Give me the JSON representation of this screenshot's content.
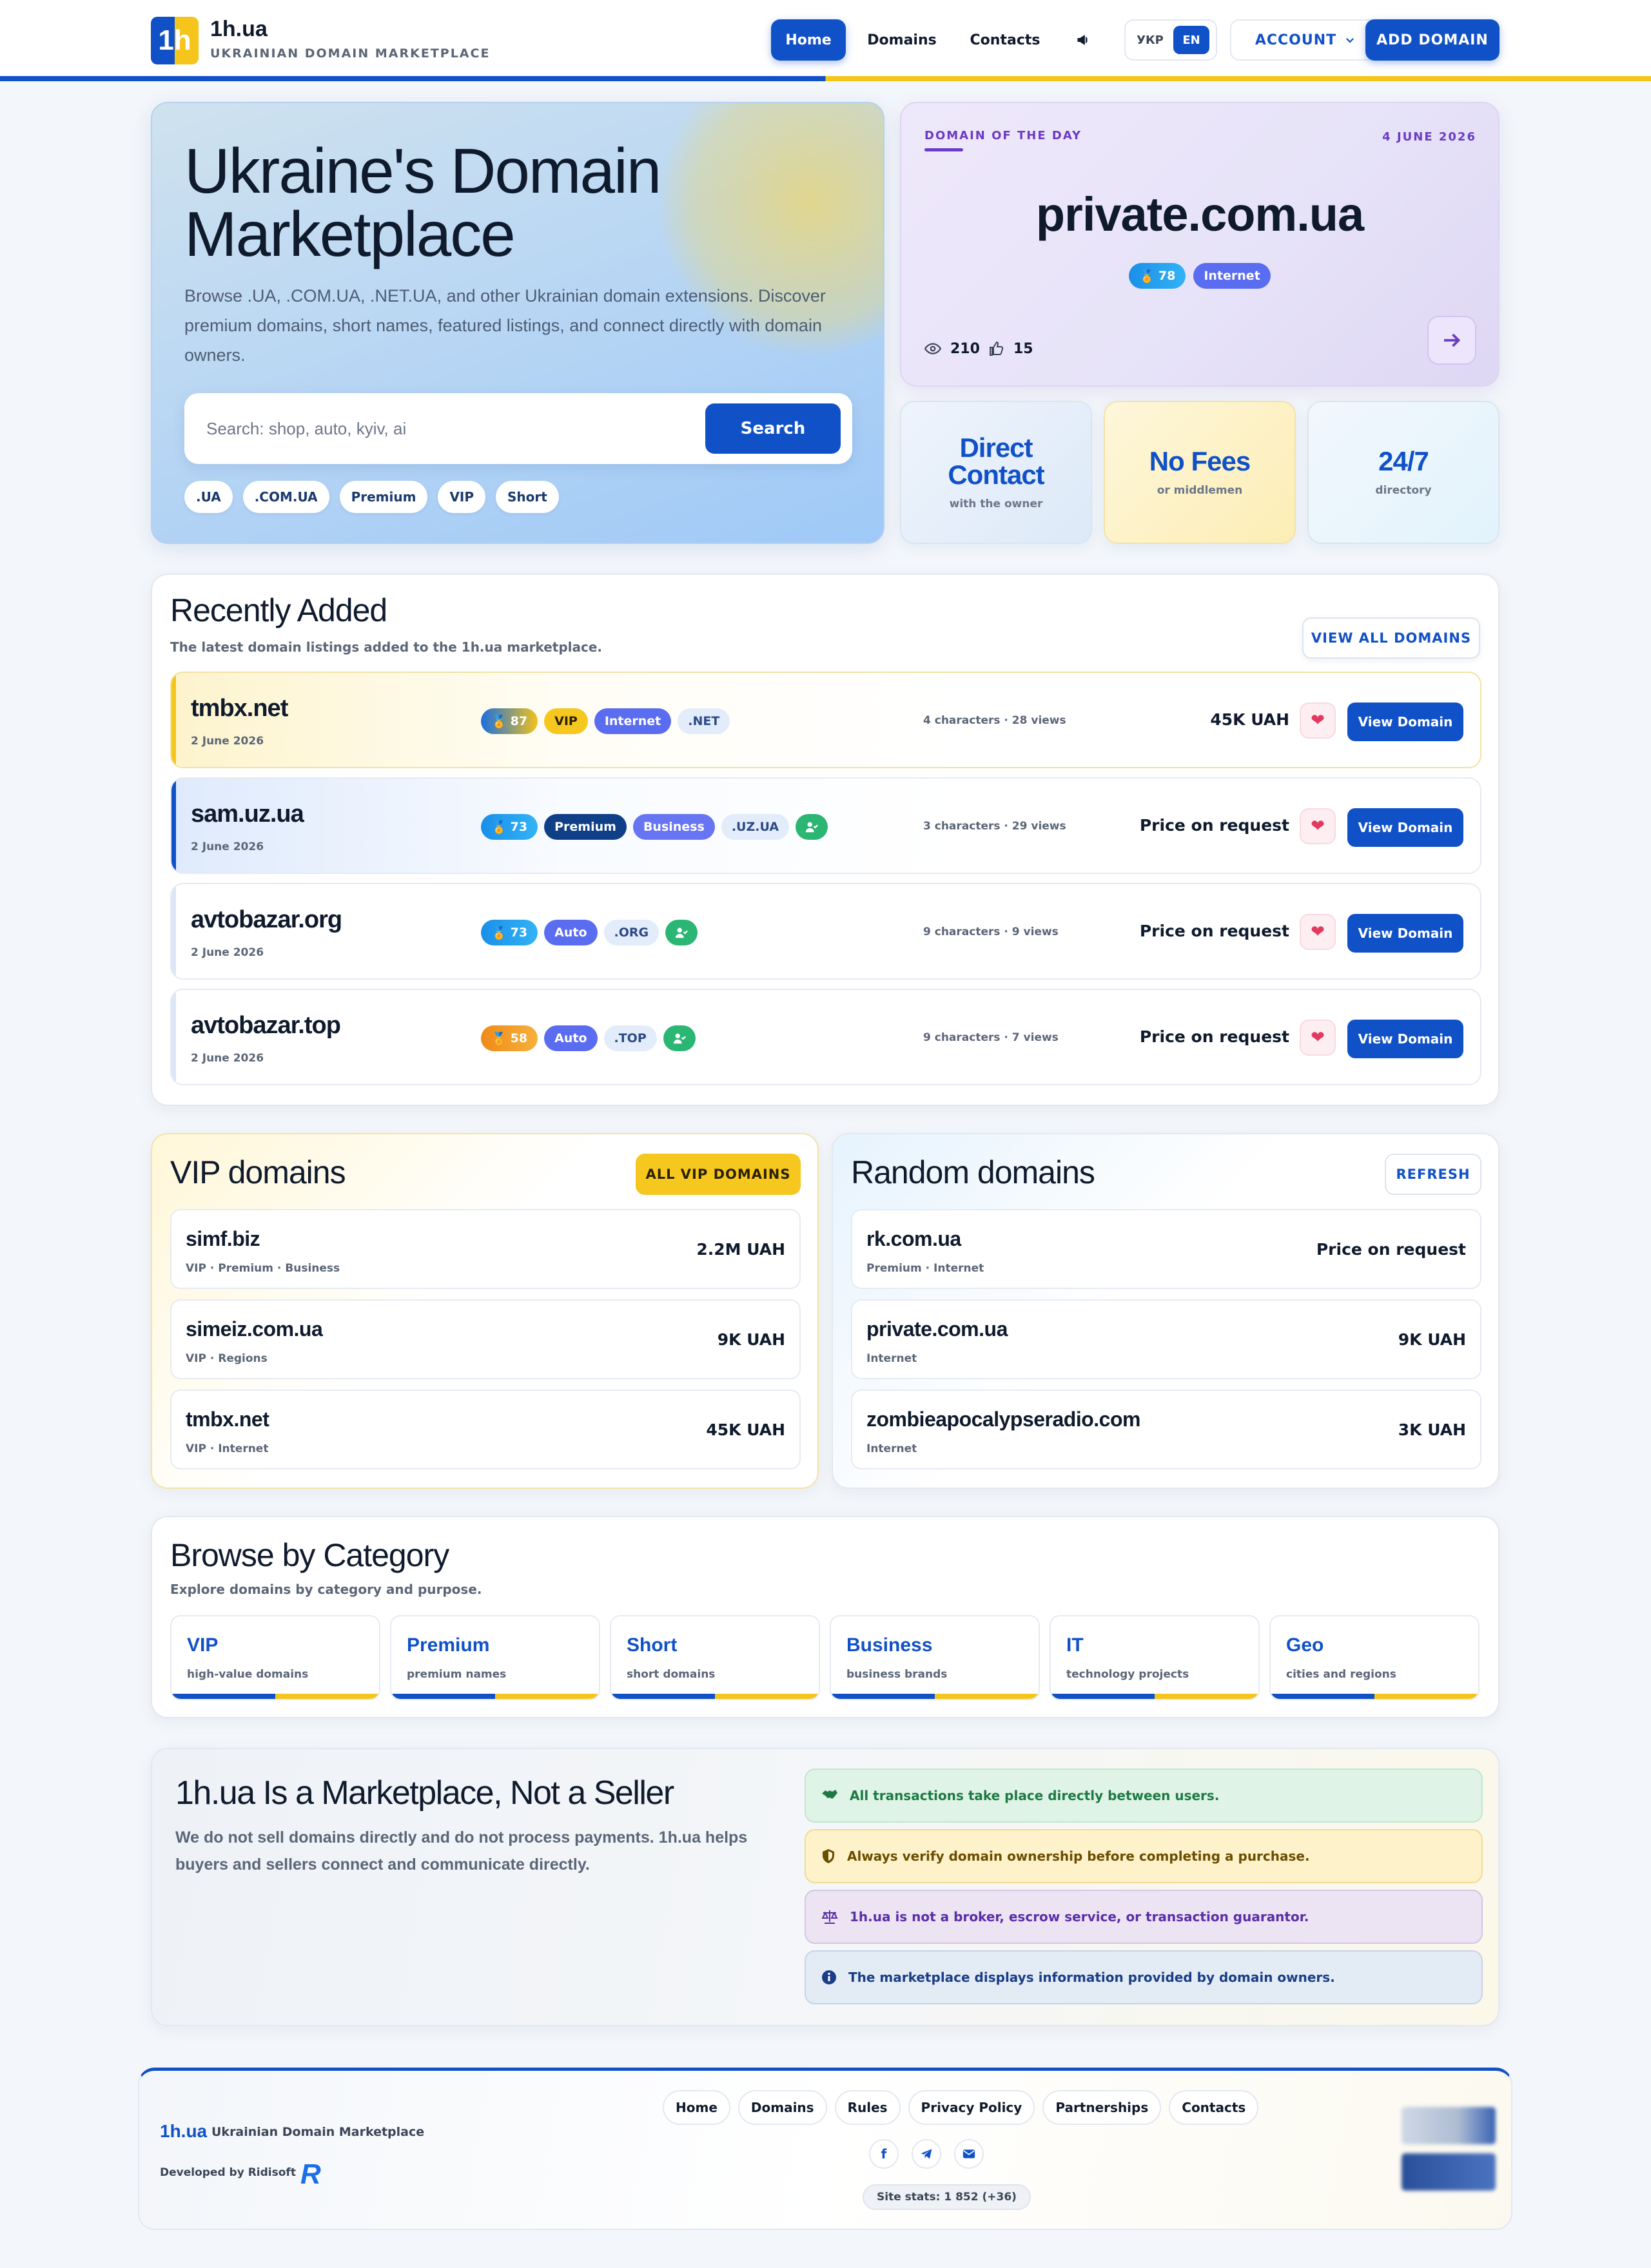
{
  "header": {
    "logo_text": "1h",
    "brand": "1h.ua",
    "tagline": "UKRAINIAN DOMAIN MARKETPLACE",
    "nav": {
      "home": "Home",
      "domains": "Domains",
      "contacts": "Contacts"
    },
    "megaphone_icon": "megaphone-icon",
    "lang": {
      "ukr": "УКР",
      "en": "EN",
      "active": "EN"
    },
    "account": "ACCOUNT",
    "add_domain": "ADD DOMAIN",
    "colors": {
      "accent": "#1151c7",
      "yellow": "#f6c51c"
    }
  },
  "hero": {
    "title": "Ukraine's Domain Marketplace",
    "subtitle": "Browse .UA, .COM.UA, .NET.UA, and other Ukrainian domain extensions. Discover premium domains, short names, featured listings, and connect directly with domain owners.",
    "search": {
      "placeholder": "Search: shop, auto, kyiv, ai",
      "value": "",
      "button": "Search"
    },
    "chips": [
      ".UA",
      ".COM.UA",
      "Premium",
      "VIP",
      "Short"
    ]
  },
  "domain_of_day": {
    "label": "DOMAIN OF THE DAY",
    "date": "4 JUNE 2026",
    "name": "private.com.ua",
    "score": "78",
    "category": "Internet",
    "views": "210",
    "likes": "15"
  },
  "features": [
    {
      "title": "Direct Contact",
      "sub": "with the owner"
    },
    {
      "title": "No Fees",
      "sub": "or middlemen"
    },
    {
      "title": "24/7",
      "sub": "directory"
    }
  ],
  "recent": {
    "title": "Recently Added",
    "subtitle": "The latest domain listings added to the 1h.ua marketplace.",
    "view_all": "VIEW ALL DOMAINS",
    "view_label": "View Domain",
    "rows": [
      {
        "name": "tmbx.net",
        "date": "2 June 2026",
        "score": "87",
        "tags": [
          "VIP",
          "Internet",
          ".NET"
        ],
        "meta": "4 characters · 28 views",
        "price": "45K UAH"
      },
      {
        "name": "sam.uz.ua",
        "date": "2 June 2026",
        "score": "73",
        "tags": [
          "Premium",
          "Business",
          ".UZ.UA"
        ],
        "meta": "3 characters · 29 views",
        "price": "Price on request"
      },
      {
        "name": "avtobazar.org",
        "date": "2 June 2026",
        "score": "73",
        "tags": [
          "Auto",
          ".ORG"
        ],
        "meta": "9 characters · 9 views",
        "price": "Price on request"
      },
      {
        "name": "avtobazar.top",
        "date": "2 June 2026",
        "score": "58",
        "tags": [
          "Auto",
          ".TOP"
        ],
        "meta": "9 characters · 7 views",
        "price": "Price on request"
      }
    ]
  },
  "vip": {
    "title": "VIP domains",
    "button": "ALL VIP DOMAINS",
    "items": [
      {
        "name": "simf.biz",
        "tags": "VIP · Premium · Business",
        "price": "2.2M UAH"
      },
      {
        "name": "simeiz.com.ua",
        "tags": "VIP · Regions",
        "price": "9K UAH"
      },
      {
        "name": "tmbx.net",
        "tags": "VIP · Internet",
        "price": "45K UAH"
      }
    ]
  },
  "random": {
    "title": "Random domains",
    "button": "REFRESH",
    "items": [
      {
        "name": "rk.com.ua",
        "tags": "Premium · Internet",
        "price": "Price on request"
      },
      {
        "name": "private.com.ua",
        "tags": "Internet",
        "price": "9K UAH"
      },
      {
        "name": "zombieapocalypseradio.com",
        "tags": "Internet",
        "price": "3K UAH"
      }
    ]
  },
  "browse": {
    "title": "Browse by Category",
    "subtitle": "Explore domains by category and purpose.",
    "categories": [
      {
        "name": "VIP",
        "sub": "high-value domains"
      },
      {
        "name": "Premium",
        "sub": "premium names"
      },
      {
        "name": "Short",
        "sub": "short domains"
      },
      {
        "name": "Business",
        "sub": "business brands"
      },
      {
        "name": "IT",
        "sub": "technology projects"
      },
      {
        "name": "Geo",
        "sub": "cities and regions"
      }
    ]
  },
  "notice": {
    "title": "1h.ua Is a Marketplace, Not a Seller",
    "text": "We do not sell domains directly and do not process payments. 1h.ua helps buyers and sellers connect and communicate directly.",
    "alerts": [
      "All transactions take place directly between users.",
      "Always verify domain ownership before completing a purchase.",
      "1h.ua is not a broker, escrow service, or transaction guarantor.",
      "The marketplace displays information provided by domain owners."
    ]
  },
  "footer": {
    "brand": "1h.ua",
    "tagline": "Ukrainian Domain Marketplace",
    "developer": "Developed by Ridisoft",
    "developer_logo": "R",
    "links": [
      "Home",
      "Domains",
      "Rules",
      "Privacy Policy",
      "Partnerships",
      "Contacts"
    ],
    "social": [
      "facebook-icon",
      "telegram-icon",
      "email-icon"
    ],
    "stats": "Site stats: 1 852 (+36)"
  }
}
